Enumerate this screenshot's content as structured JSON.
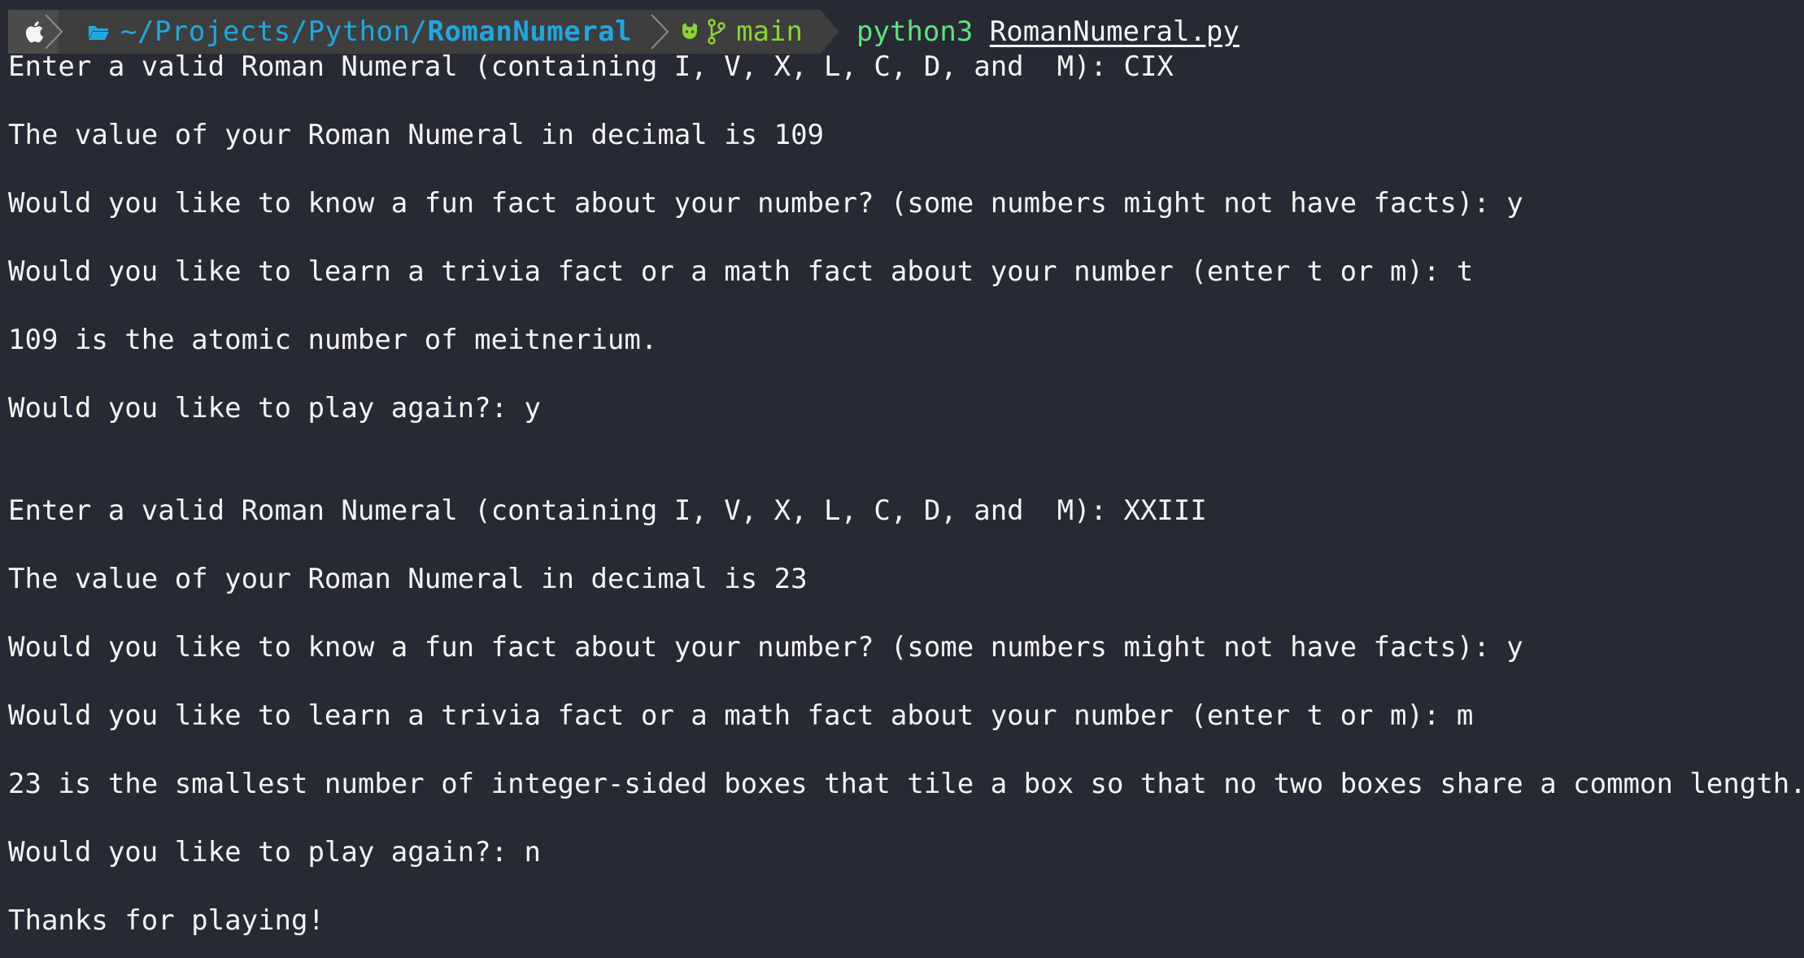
{
  "prompt": {
    "os_icon": "apple-icon",
    "folder_icon": "folder-icon",
    "path_prefix": "~/Projects/Python/",
    "path_current": "RomanNumeral",
    "git_icon": "github-icon",
    "branch_icon": "branch-icon",
    "branch": "main",
    "command_exe": "python3",
    "command_arg": "RomanNumeral.py",
    "colors": {
      "path": "#1fa8e0",
      "branch": "#8ad334",
      "command": "#5ce67a",
      "background": "#272935"
    }
  },
  "session": {
    "run1": [
      "Enter a valid Roman Numeral (containing I, V, X, L, C, D, and  M): CIX",
      "The value of your Roman Numeral in decimal is 109",
      "Would you like to know a fun fact about your number? (some numbers might not have facts): y",
      "Would you like to learn a trivia fact or a math fact about your number (enter t or m): t",
      "109 is the atomic number of meitnerium.",
      "Would you like to play again?: y"
    ],
    "run2": [
      "Enter a valid Roman Numeral (containing I, V, X, L, C, D, and  M): XXIII",
      "The value of your Roman Numeral in decimal is 23",
      "Would you like to know a fun fact about your number? (some numbers might not have facts): y",
      "Would you like to learn a trivia fact or a math fact about your number (enter t or m): m",
      "23 is the smallest number of integer-sided boxes that tile a box so that no two boxes share a common length.",
      "Would you like to play again?: n",
      "Thanks for playing!"
    ]
  }
}
